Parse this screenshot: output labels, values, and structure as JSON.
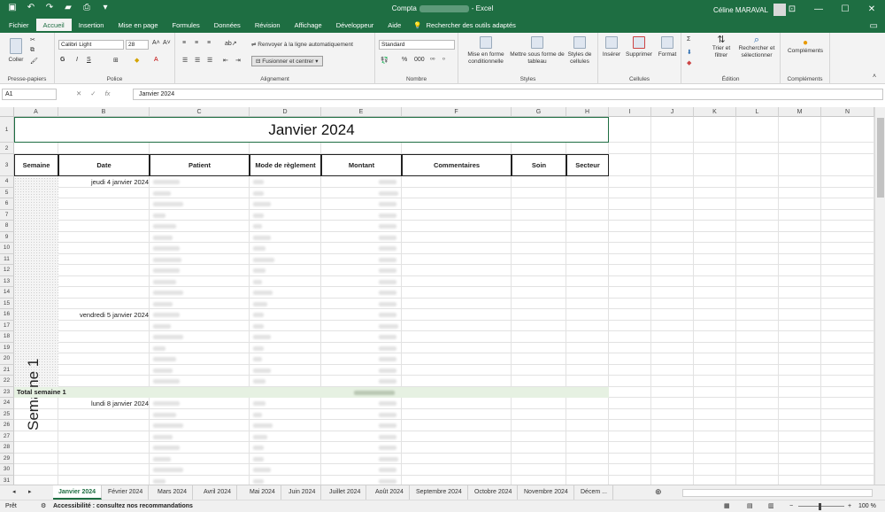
{
  "window": {
    "title_prefix": "Compta",
    "title_suffix": "-  Excel",
    "user_name": "Céline MARAVAL"
  },
  "ribbon_tabs": [
    "Fichier",
    "Accueil",
    "Insertion",
    "Mise en page",
    "Formules",
    "Données",
    "Révision",
    "Affichage",
    "Développeur",
    "Aide"
  ],
  "active_tab": "Accueil",
  "tell_me": "Rechercher des outils adaptés",
  "ribbon": {
    "clipboard": {
      "paste": "Coller",
      "label": "Presse-papiers"
    },
    "font": {
      "name": "Calibri Light",
      "size": "28",
      "label": "Police"
    },
    "alignment": {
      "wrap": "Renvoyer à la ligne automatiquement",
      "merge": "Fusionner et centrer",
      "label": "Alignement"
    },
    "number": {
      "format": "Standard",
      "label": "Nombre"
    },
    "styles": {
      "conditional": "Mise en forme conditionnelle",
      "table": "Mettre sous forme de tableau",
      "cell_styles": "Styles de cellules",
      "label": "Styles"
    },
    "cells": {
      "insert": "Insérer",
      "delete": "Supprimer",
      "format": "Format",
      "label": "Cellules"
    },
    "editing": {
      "sort": "Trier et filtrer",
      "find": "Rechercher et sélectionner",
      "label": "Édition"
    },
    "addins": {
      "addins": "Compléments",
      "label": "Compléments"
    }
  },
  "formula_bar": {
    "name_box": "A1",
    "value": "Janvier 2024"
  },
  "columns": [
    "A",
    "B",
    "C",
    "D",
    "E",
    "F",
    "G",
    "H",
    "I",
    "J",
    "K",
    "L",
    "M",
    "N"
  ],
  "sheet": {
    "title": "Janvier 2024",
    "headers": [
      "Semaine",
      "Date",
      "Patient",
      "Mode de règlement",
      "Montant",
      "Commentaires",
      "Soin",
      "Secteur"
    ],
    "week_label": "Semaine 1",
    "dates": [
      {
        "row": 4,
        "text": "jeudi 4 janvier 2024"
      },
      {
        "row": 16,
        "text": "vendredi 5 janvier 2024"
      },
      {
        "row": 24,
        "text": "lundi 8 janvier 2024"
      }
    ],
    "total_label": "Total semaine 1"
  },
  "sheet_tabs": [
    "Janvier 2024",
    "Février 2024",
    "Mars 2024",
    "Avril 2024",
    "Mai 2024",
    "Juin 2024",
    "Juillet 2024",
    "Août 2024",
    "Septembre 2024",
    "Octobre 2024",
    "Novembre 2024",
    "Décem ..."
  ],
  "status": {
    "ready": "Prêt",
    "accessibility": "Accessibilité : consultez nos recommandations",
    "zoom": "100 %"
  }
}
